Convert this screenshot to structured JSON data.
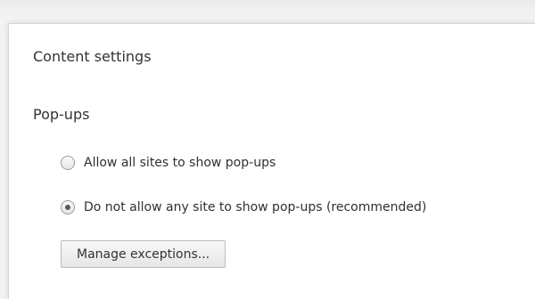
{
  "dialog": {
    "title": "Content settings"
  },
  "popups": {
    "section_title": "Pop-ups",
    "options": [
      {
        "label": "Allow all sites to show pop-ups",
        "selected": false
      },
      {
        "label": "Do not allow any site to show pop-ups (recommended)",
        "selected": true
      }
    ],
    "manage_button_label": "Manage exceptions..."
  }
}
